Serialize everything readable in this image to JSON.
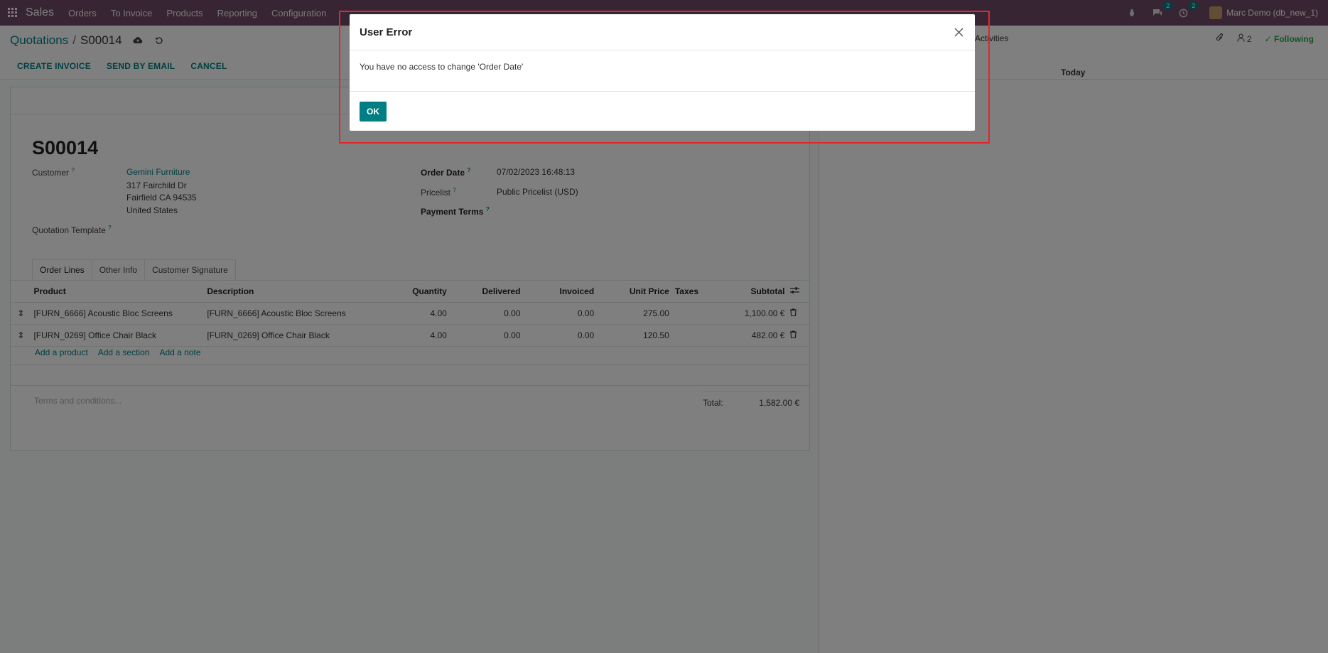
{
  "navbar": {
    "app": "Sales",
    "menus": [
      "Orders",
      "To Invoice",
      "Products",
      "Reporting",
      "Configuration"
    ],
    "messages_count": "2",
    "activities_count": "2",
    "user": "Marc Demo (db_new_1)"
  },
  "control": {
    "breadcrumb_parent": "Quotations",
    "breadcrumb_sep": "/",
    "breadcrumb_current": "S00014",
    "actions": [
      "CREATE INVOICE",
      "SEND BY EMAIL",
      "CANCEL"
    ],
    "activities_label": "Activities",
    "followers_count": "2",
    "following_label": "Following"
  },
  "form": {
    "title": "S00014",
    "customer_label": "Customer",
    "customer_name": "Gemini Furniture",
    "customer_address1": "317 Fairchild Dr",
    "customer_address2": "Fairfield CA 94535",
    "customer_address3": "United States",
    "quotation_template_label": "Quotation Template",
    "order_date_label": "Order Date",
    "order_date_value": "07/02/2023 16:48:13",
    "pricelist_label": "Pricelist",
    "pricelist_value": "Public Pricelist (USD)",
    "payment_terms_label": "Payment Terms",
    "tooltip_mark": "?",
    "tabs": [
      "Order Lines",
      "Other Info",
      "Customer Signature"
    ],
    "columns": [
      "Product",
      "Description",
      "Quantity",
      "Delivered",
      "Invoiced",
      "Unit Price",
      "Taxes",
      "Subtotal"
    ],
    "lines": [
      {
        "product": "[FURN_6666] Acoustic Bloc Screens",
        "description": "[FURN_6666] Acoustic Bloc Screens",
        "quantity": "4.00",
        "delivered": "0.00",
        "invoiced": "0.00",
        "unit_price": "275.00",
        "taxes": "",
        "subtotal": "1,100.00 €"
      },
      {
        "product": "[FURN_0269] Office Chair Black",
        "description": "[FURN_0269] Office Chair Black",
        "quantity": "4.00",
        "delivered": "0.00",
        "invoiced": "0.00",
        "unit_price": "120.50",
        "taxes": "",
        "subtotal": "482.00 €"
      }
    ],
    "add_links": [
      "Add a product",
      "Add a section",
      "Add a note"
    ],
    "terms_placeholder": "Terms and conditions...",
    "total_label": "Total:",
    "total_value": "1,582.00 €"
  },
  "chatter": {
    "today_label": "Today"
  },
  "dialog": {
    "title": "User Error",
    "message": "You have no access to change 'Order Date'",
    "ok_label": "OK"
  },
  "colors": {
    "navbar": "#714B67",
    "accent": "#017e84",
    "highlight": "#e3262b"
  }
}
